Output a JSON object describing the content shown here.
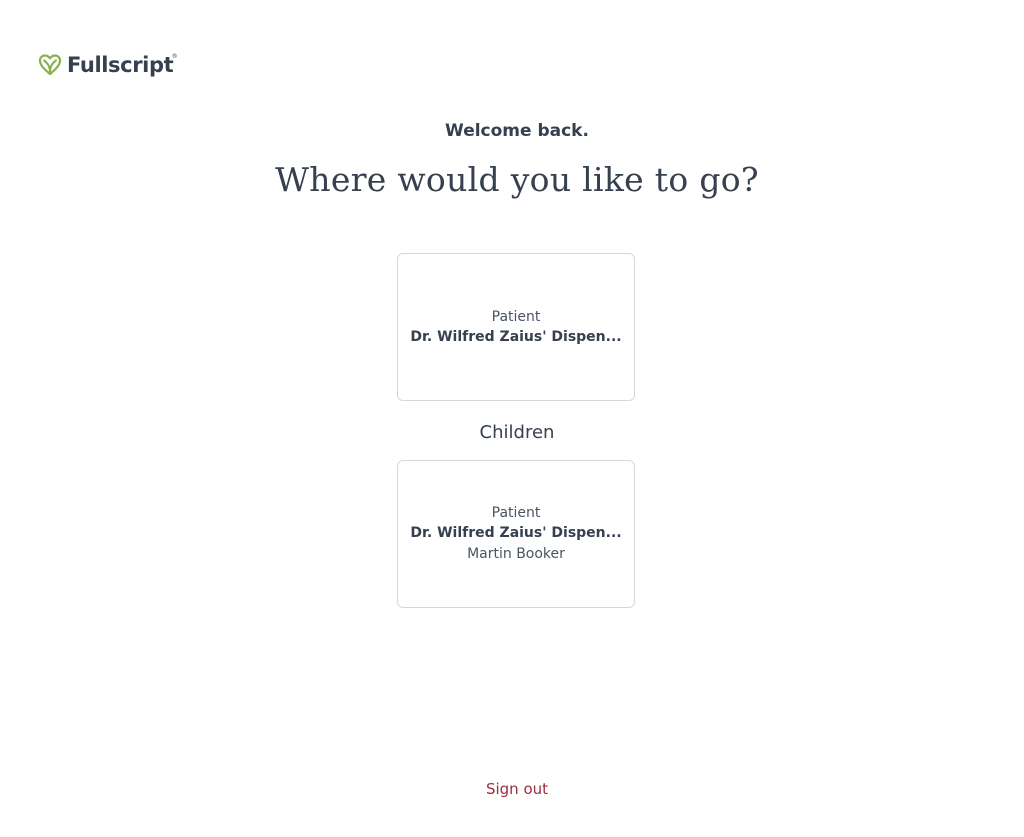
{
  "brand": {
    "name": "Fullscript",
    "trademark": "®",
    "logo_icon": "leaf-heart-icon",
    "logo_color": "#88b04b"
  },
  "header": {
    "welcome": "Welcome back.",
    "title": "Where would you like to go?"
  },
  "accounts": [
    {
      "role": "Patient",
      "store": "Dr. Wilfred Zaius' Dispen..."
    }
  ],
  "children_section": {
    "label": "Children",
    "accounts": [
      {
        "role": "Patient",
        "store": "Dr. Wilfred Zaius' Dispen...",
        "person": "Martin Booker"
      }
    ]
  },
  "footer": {
    "sign_out": "Sign out"
  },
  "colors": {
    "text": "#36404f",
    "card_border": "#d5d8dc",
    "sign_out": "#9e2c3e"
  }
}
